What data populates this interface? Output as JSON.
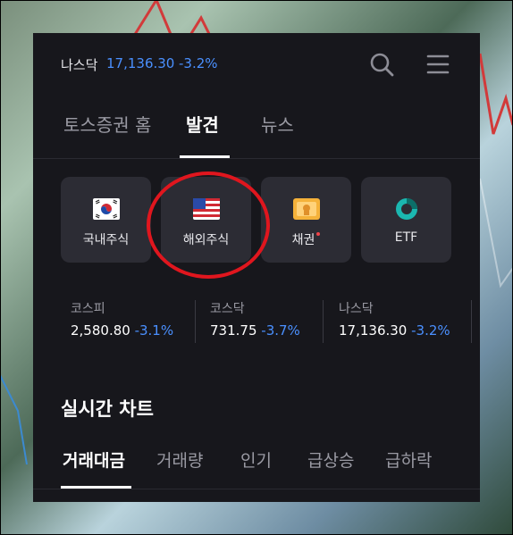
{
  "ticker": {
    "name": "나스닥",
    "value": "17,136.30",
    "change": "-3.2%"
  },
  "main_tabs": [
    {
      "label": "토스증권 홈",
      "active": false
    },
    {
      "label": "발견",
      "active": true
    },
    {
      "label": "뉴스",
      "active": false
    }
  ],
  "categories": [
    {
      "label": "국내주식",
      "icon": "korea-flag-icon"
    },
    {
      "label": "해외주식",
      "icon": "us-flag-icon",
      "highlighted": true
    },
    {
      "label": "채권",
      "icon": "bond-icon",
      "new_badge": true
    },
    {
      "label": "ETF",
      "icon": "etf-donut-icon"
    }
  ],
  "indices": [
    {
      "name": "코스피",
      "value": "2,580.80",
      "change": "-3.1%"
    },
    {
      "name": "코스닥",
      "value": "731.75",
      "change": "-3.7%"
    },
    {
      "name": "나스닥",
      "value": "17,136.30",
      "change": "-3.2%"
    }
  ],
  "section": {
    "title": "실시간 차트"
  },
  "chart_tabs": [
    {
      "label": "거래대금",
      "active": true
    },
    {
      "label": "거래량",
      "active": false
    },
    {
      "label": "인기",
      "active": false
    },
    {
      "label": "급상승",
      "active": false
    },
    {
      "label": "급하락",
      "active": false
    }
  ],
  "colors": {
    "accent_blue": "#4a90ff",
    "annotation_red": "#e0161e",
    "panel_bg": "#17171c",
    "card_bg": "#2c2c34"
  }
}
